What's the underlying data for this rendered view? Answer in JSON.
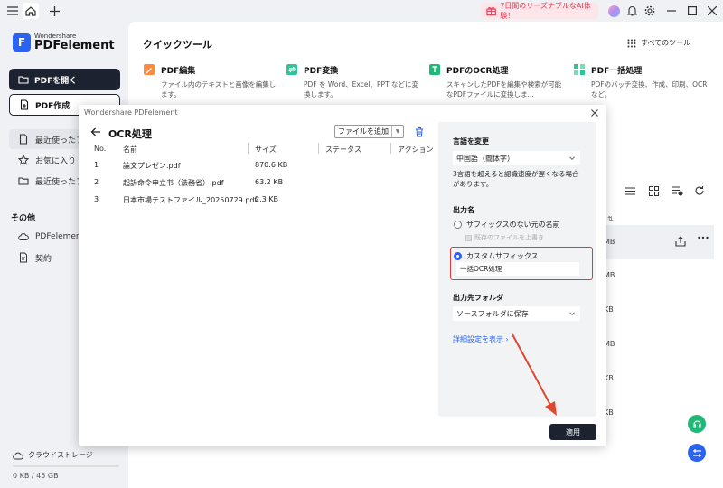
{
  "promo": {
    "text": "7日間のリーズナブルなAI体験！"
  },
  "logo": {
    "small": "Wondershare",
    "big": "PDFelement",
    "mark": "F"
  },
  "sidebar": {
    "open_label": "PDFを開く",
    "create_label": "PDF作成",
    "items": [
      {
        "label": "最近使ったフ"
      },
      {
        "label": "お気に入り"
      },
      {
        "label": "最近使ったフ"
      }
    ],
    "section_title": "その他",
    "other_items": [
      {
        "label": "PDFelement"
      },
      {
        "label": "契約"
      }
    ],
    "cloud_label": "クラウドストレージ",
    "storage": "0 KB / 45 GB"
  },
  "quick_tools": {
    "title": "クイックツール",
    "all_tools": "すべてのツール",
    "tools": [
      {
        "name": "PDF編集",
        "desc": "ファイル内のテキストと画像を編集します。"
      },
      {
        "name": "PDF変換",
        "desc": "PDF を Word、Excel、PPT などに変換します。"
      },
      {
        "name": "PDFのOCR処理",
        "desc": "スキャンしたPDFを編集や検索が可能なPDFファイルに変換しま..."
      },
      {
        "name": "PDF一括処理",
        "desc": "PDFのバッチ変換、作成、印刷、OCRなど。"
      }
    ]
  },
  "bg_list": {
    "sort_icon_text": "⇅",
    "sizes": [
      "MB",
      "MB",
      "KB",
      "MB",
      "KB",
      "KB"
    ]
  },
  "modal": {
    "app_title": "Wondershare PDFelement",
    "title": "OCR処理",
    "add_file": "ファイルを追加",
    "columns": {
      "no": "No.",
      "name": "名前",
      "size": "サイズ",
      "status": "ステータス",
      "action": "アクション"
    },
    "rows": [
      {
        "no": "1",
        "name": "論文プレゼン.pdf",
        "size": "870.6 KB"
      },
      {
        "no": "2",
        "name": "起訴命令申立书（法務省）.pdf",
        "size": "63.2 KB"
      },
      {
        "no": "3",
        "name": "日本市場テストファイル_20250729.pdf",
        "size": "2.3 KB"
      }
    ],
    "panel": {
      "lang_label": "言語を変更",
      "lang_value": "中国語（簡体字）",
      "lang_note": "3言語を超えると認識速度が遅くなる場合があります。",
      "output_name_label": "出力名",
      "option_no_suffix": "サフィックスのない元の名前",
      "overwrite": "既存のファイルを上書き",
      "option_custom": "カスタムサフィックス",
      "suffix_value": "一括OCR処理",
      "folder_label": "出力先フォルダ",
      "folder_value": "ソースフォルダに保存",
      "advanced": "詳細設定を表示 ›"
    },
    "apply": "適用"
  },
  "colors": {
    "accent": "#2a63f0",
    "dark": "#1d2230",
    "highlight": "#e23a3a",
    "promo": "#e23a52"
  }
}
